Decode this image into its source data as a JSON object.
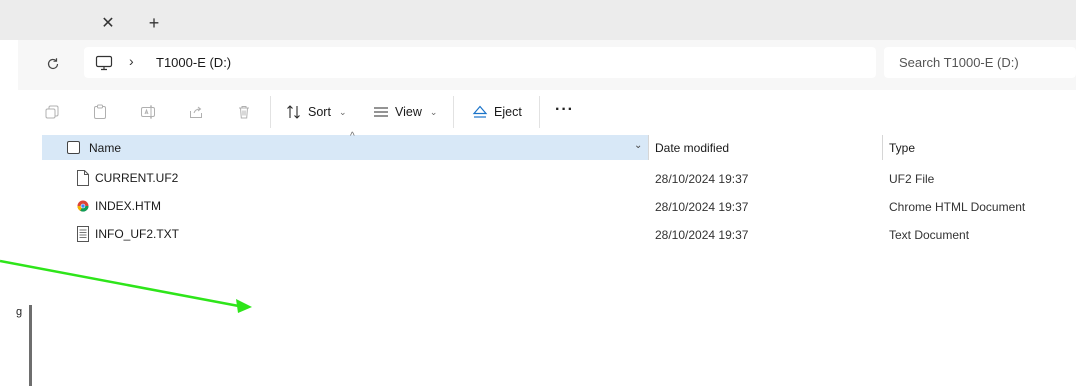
{
  "tabstrip": {
    "close_glyph": "✕",
    "new_tab_glyph": "+"
  },
  "address": {
    "refresh_icon": "refresh-icon",
    "location_icon": "this-pc-icon",
    "breadcrumb_chevron": "›",
    "location": "T1000-E (D:)",
    "search_placeholder": "Search T1000-E (D:)"
  },
  "toolbar": {
    "icons": [
      "copy-icon",
      "paste-icon",
      "rename-icon",
      "share-icon",
      "delete-icon"
    ],
    "sort_label": "Sort",
    "view_label": "View",
    "eject_label": "Eject",
    "more_label": "···"
  },
  "columns": {
    "name": "Name",
    "date_modified": "Date modified",
    "type": "Type",
    "sort_indicator": "^",
    "dropdown_indicator": "⌄"
  },
  "files": [
    {
      "name": "CURRENT.UF2",
      "date": "28/10/2024 19:37",
      "type": "UF2 File",
      "icon": "file-icon"
    },
    {
      "name": "INDEX.HTM",
      "date": "28/10/2024 19:37",
      "type": "Chrome HTML Document",
      "icon": "chrome-icon"
    },
    {
      "name": "INFO_UF2.TXT",
      "date": "28/10/2024 19:37",
      "type": "Text Document",
      "icon": "text-file-icon"
    }
  ],
  "annotation": {
    "color": "#2ee51a"
  },
  "left_edge_char": "g"
}
